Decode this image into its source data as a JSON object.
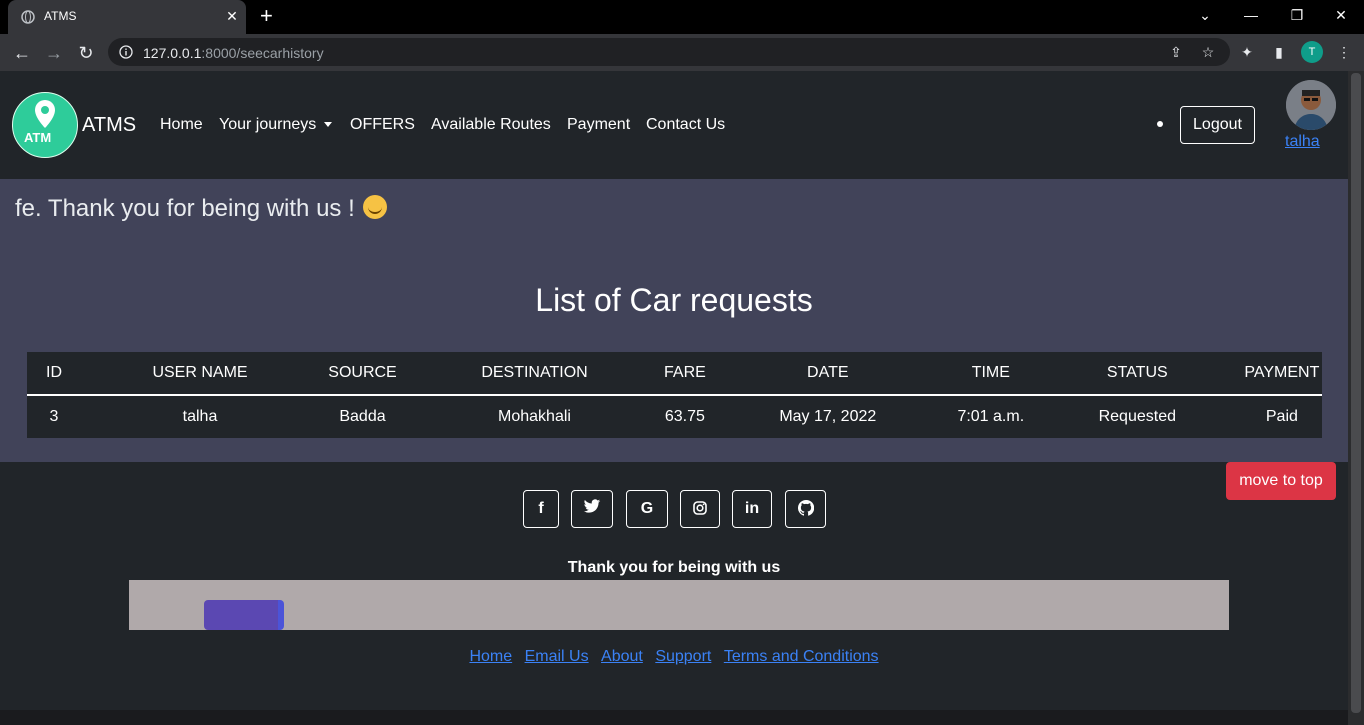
{
  "browser": {
    "tab_title": "ATMS",
    "tab_close": "✕",
    "new_tab": "+",
    "url_host": "127.0.0.1",
    "url_rest": ":8000/seecarhistory",
    "profile_initial": "T",
    "window_controls": {
      "chevron": "⌄",
      "minimize": "—",
      "restore": "❐",
      "close": "✕"
    }
  },
  "navbar": {
    "logo_text": "ATM",
    "brand": "ATMS",
    "links": [
      "Home",
      "Your journeys",
      "OFFERS",
      "Available Routes",
      "Payment",
      "Contact Us"
    ],
    "logout_label": "Logout",
    "username": "talha"
  },
  "main": {
    "marquee_text": "fe. Thank you for being with us !",
    "heading": "List of Car requests",
    "table": {
      "headers": [
        "ID",
        "USER NAME",
        "SOURCE",
        "DESTINATION",
        "FARE",
        "DATE",
        "TIME",
        "STATUS",
        "PAYMENT"
      ],
      "rows": [
        [
          "3",
          "talha",
          "Badda",
          "Mohakhali",
          "63.75",
          "May 17, 2022",
          "7:01 a.m.",
          "Requested",
          "Paid"
        ]
      ]
    }
  },
  "footer": {
    "social": [
      {
        "icon": "facebook-icon",
        "glyph": "f"
      },
      {
        "icon": "twitter-icon",
        "glyph": "🐦"
      },
      {
        "icon": "google-icon",
        "glyph": "G"
      },
      {
        "icon": "instagram-icon",
        "glyph": "◎"
      },
      {
        "icon": "linkedin-icon",
        "glyph": "in"
      },
      {
        "icon": "github-icon",
        "glyph": "●"
      }
    ],
    "move_to_top": "move to top",
    "thanks": "Thank you for being with us",
    "links": [
      "Home",
      "Email Us",
      "About",
      "Support",
      "Terms and Conditions"
    ]
  },
  "colors": {
    "navbar_bg": "#212529",
    "content_bg": "#414359",
    "danger": "#dc3545",
    "link": "#3b82f6"
  }
}
